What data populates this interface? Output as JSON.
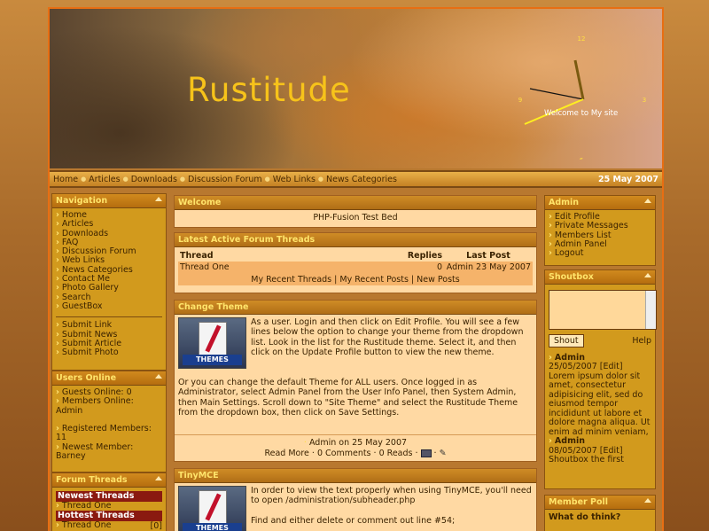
{
  "header": {
    "site_title": "Rustitude",
    "welcome": "Welcome to My site",
    "clock_nums": [
      "12",
      "3",
      "6",
      "9"
    ]
  },
  "nav": {
    "items": [
      "Home",
      "Articles",
      "Downloads",
      "Discussion Forum",
      "Web Links",
      "News Categories"
    ],
    "date": "25 May 2007"
  },
  "navigation": {
    "title": "Navigation",
    "links": [
      "Home",
      "Articles",
      "Downloads",
      "FAQ",
      "Discussion Forum",
      "Web Links",
      "News Categories",
      "Contact Me",
      "Photo Gallery",
      "Search",
      "GuestBox"
    ],
    "submit_links": [
      "Submit Link",
      "Submit News",
      "Submit Article",
      "Submit Photo"
    ]
  },
  "users_online": {
    "title": "Users Online",
    "guests": "Guests Online: 0",
    "members": "Members Online:",
    "member_name": "Admin",
    "registered_label": "Registered Members:",
    "registered_count": "11",
    "newest_label": "Newest Member:",
    "newest_name": "Barney"
  },
  "forum_threads": {
    "title": "Forum Threads",
    "newest_label": "Newest Threads",
    "newest_item": "Thread One",
    "hottest_label": "Hottest Threads",
    "hottest_item": "Thread One",
    "hottest_count": "[0]"
  },
  "welcome": {
    "title": "Welcome",
    "text": "PHP-Fusion Test Bed"
  },
  "latest_threads": {
    "title": "Latest Active Forum Threads",
    "headers": [
      "Thread",
      "Replies",
      "Last Post"
    ],
    "row": {
      "thread": "Thread One",
      "replies": "0",
      "user": "Admin",
      "date": "23 May 2007"
    },
    "footer": [
      "My Recent Threads",
      "My Recent Posts",
      "New Posts"
    ]
  },
  "article1": {
    "title": "Change Theme",
    "thumb_label": "THEMES",
    "p1": "As a user. Login and then click on Edit Profile. You will see a few lines below the option to change your theme from the dropdown list. Look in the list for the Rustitude theme. Select it, and then click on the Update Profile button to view the new theme.",
    "p2": "Or you can change the default Theme for ALL users. Once logged in as Administrator, select Admin Panel from the User Info Panel, then System Admin, then Main Settings. Scroll down to \"Site Theme\" and select the Rustitude Theme from the dropdown box, then click on Save Settings.",
    "author_line": "Admin on 25 May 2007",
    "read_more": "Read More",
    "comments": "0 Comments",
    "reads": "0 Reads"
  },
  "article2": {
    "title": "TinyMCE",
    "thumb_label": "THEMES",
    "p1": "In order to view the text properly when using TinyMCE, you'll need to open /administration/subheader.php",
    "p2": "Find and either delete or comment out line #54;"
  },
  "admin": {
    "title": "Admin",
    "links": [
      "Edit Profile",
      "Private Messages",
      "Members List",
      "Admin Panel",
      "Logout"
    ]
  },
  "shoutbox": {
    "title": "Shoutbox",
    "shout_button": "Shout",
    "help": "Help",
    "s1_name": "Admin",
    "s1_date": "25/05/2007",
    "s1_edit": "Edit",
    "s1_text": "Lorem ipsum dolor sit amet, consectetur adipisicing elit, sed do eiusmod tempor incididunt ut labore et dolore magna aliqua. Ut enim ad minim veniam,",
    "s2_name": "Admin",
    "s2_date": "08/05/2007",
    "s2_edit": "Edit",
    "s2_text": "Shoutbox the first"
  },
  "poll": {
    "title": "Member Poll",
    "question": "What do think?"
  }
}
